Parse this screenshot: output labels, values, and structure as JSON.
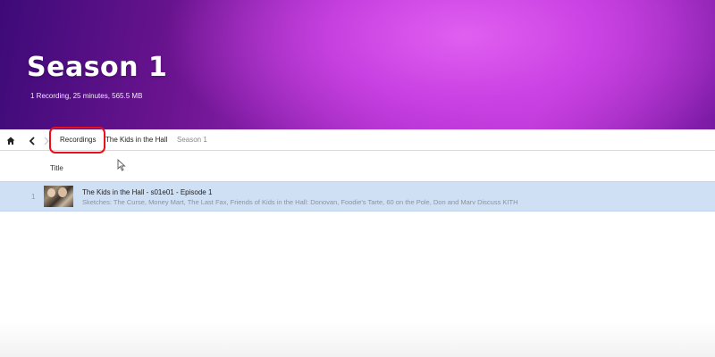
{
  "hero": {
    "title": "Season 1",
    "subtitle": "1 Recording, 25 minutes, 565.5 MB"
  },
  "nav": {
    "home_icon": "home-icon",
    "back_icon": "chevron-left-icon",
    "separator_icon": "chevron-right-icon",
    "breadcrumbs": [
      "Recordings",
      "The Kids in the Hall",
      "Season 1"
    ]
  },
  "table": {
    "columns": [
      "Title"
    ],
    "rows": [
      {
        "index": "1",
        "title": "The Kids in the Hall - s01e01 - Episode 1",
        "description": "Sketches: The Curse, Money Mart, The Last Fax, Friends of Kids in the Hall: Donovan, Foodie's Tarte, 60 on the Pole, Don and Marv Discuss KITH"
      }
    ]
  },
  "colors": {
    "hero_primary": "#a428c4",
    "selected_row": "#cfe0f5",
    "highlight": "#e8101a"
  }
}
